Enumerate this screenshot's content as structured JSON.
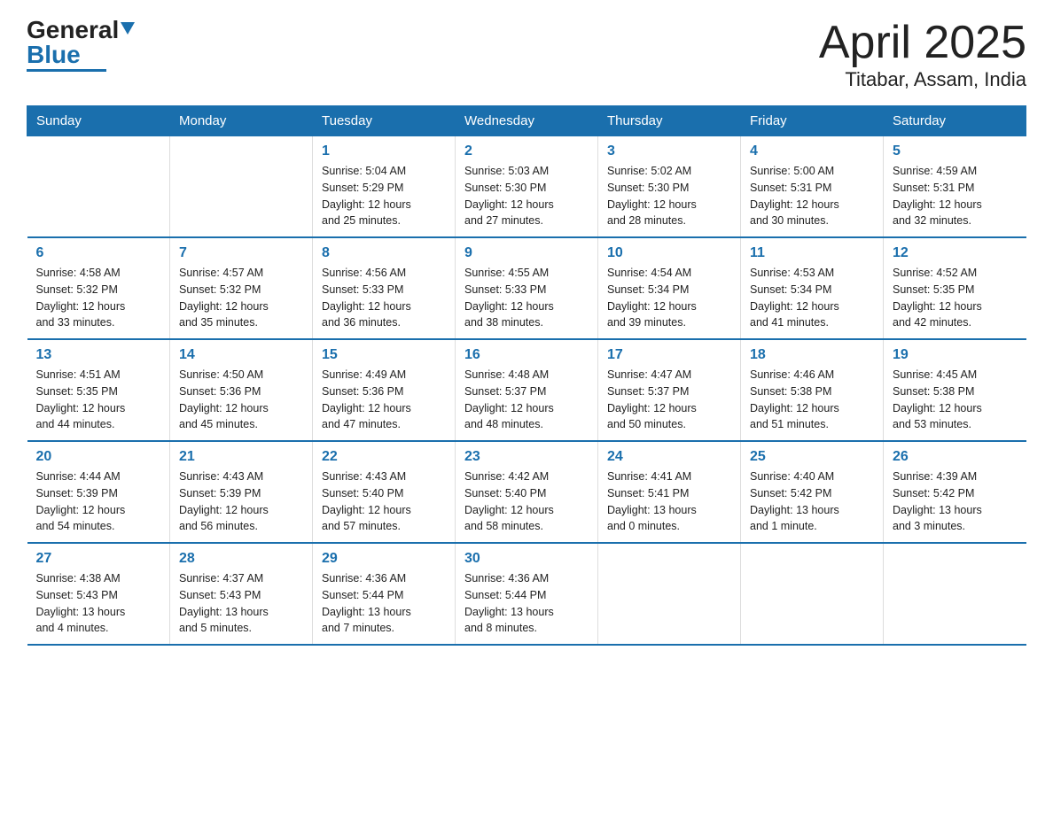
{
  "header": {
    "logo_general": "General",
    "logo_blue": "Blue",
    "month": "April 2025",
    "location": "Titabar, Assam, India"
  },
  "weekdays": [
    "Sunday",
    "Monday",
    "Tuesday",
    "Wednesday",
    "Thursday",
    "Friday",
    "Saturday"
  ],
  "weeks": [
    [
      {
        "day": "",
        "info": ""
      },
      {
        "day": "",
        "info": ""
      },
      {
        "day": "1",
        "info": "Sunrise: 5:04 AM\nSunset: 5:29 PM\nDaylight: 12 hours\nand 25 minutes."
      },
      {
        "day": "2",
        "info": "Sunrise: 5:03 AM\nSunset: 5:30 PM\nDaylight: 12 hours\nand 27 minutes."
      },
      {
        "day": "3",
        "info": "Sunrise: 5:02 AM\nSunset: 5:30 PM\nDaylight: 12 hours\nand 28 minutes."
      },
      {
        "day": "4",
        "info": "Sunrise: 5:00 AM\nSunset: 5:31 PM\nDaylight: 12 hours\nand 30 minutes."
      },
      {
        "day": "5",
        "info": "Sunrise: 4:59 AM\nSunset: 5:31 PM\nDaylight: 12 hours\nand 32 minutes."
      }
    ],
    [
      {
        "day": "6",
        "info": "Sunrise: 4:58 AM\nSunset: 5:32 PM\nDaylight: 12 hours\nand 33 minutes."
      },
      {
        "day": "7",
        "info": "Sunrise: 4:57 AM\nSunset: 5:32 PM\nDaylight: 12 hours\nand 35 minutes."
      },
      {
        "day": "8",
        "info": "Sunrise: 4:56 AM\nSunset: 5:33 PM\nDaylight: 12 hours\nand 36 minutes."
      },
      {
        "day": "9",
        "info": "Sunrise: 4:55 AM\nSunset: 5:33 PM\nDaylight: 12 hours\nand 38 minutes."
      },
      {
        "day": "10",
        "info": "Sunrise: 4:54 AM\nSunset: 5:34 PM\nDaylight: 12 hours\nand 39 minutes."
      },
      {
        "day": "11",
        "info": "Sunrise: 4:53 AM\nSunset: 5:34 PM\nDaylight: 12 hours\nand 41 minutes."
      },
      {
        "day": "12",
        "info": "Sunrise: 4:52 AM\nSunset: 5:35 PM\nDaylight: 12 hours\nand 42 minutes."
      }
    ],
    [
      {
        "day": "13",
        "info": "Sunrise: 4:51 AM\nSunset: 5:35 PM\nDaylight: 12 hours\nand 44 minutes."
      },
      {
        "day": "14",
        "info": "Sunrise: 4:50 AM\nSunset: 5:36 PM\nDaylight: 12 hours\nand 45 minutes."
      },
      {
        "day": "15",
        "info": "Sunrise: 4:49 AM\nSunset: 5:36 PM\nDaylight: 12 hours\nand 47 minutes."
      },
      {
        "day": "16",
        "info": "Sunrise: 4:48 AM\nSunset: 5:37 PM\nDaylight: 12 hours\nand 48 minutes."
      },
      {
        "day": "17",
        "info": "Sunrise: 4:47 AM\nSunset: 5:37 PM\nDaylight: 12 hours\nand 50 minutes."
      },
      {
        "day": "18",
        "info": "Sunrise: 4:46 AM\nSunset: 5:38 PM\nDaylight: 12 hours\nand 51 minutes."
      },
      {
        "day": "19",
        "info": "Sunrise: 4:45 AM\nSunset: 5:38 PM\nDaylight: 12 hours\nand 53 minutes."
      }
    ],
    [
      {
        "day": "20",
        "info": "Sunrise: 4:44 AM\nSunset: 5:39 PM\nDaylight: 12 hours\nand 54 minutes."
      },
      {
        "day": "21",
        "info": "Sunrise: 4:43 AM\nSunset: 5:39 PM\nDaylight: 12 hours\nand 56 minutes."
      },
      {
        "day": "22",
        "info": "Sunrise: 4:43 AM\nSunset: 5:40 PM\nDaylight: 12 hours\nand 57 minutes."
      },
      {
        "day": "23",
        "info": "Sunrise: 4:42 AM\nSunset: 5:40 PM\nDaylight: 12 hours\nand 58 minutes."
      },
      {
        "day": "24",
        "info": "Sunrise: 4:41 AM\nSunset: 5:41 PM\nDaylight: 13 hours\nand 0 minutes."
      },
      {
        "day": "25",
        "info": "Sunrise: 4:40 AM\nSunset: 5:42 PM\nDaylight: 13 hours\nand 1 minute."
      },
      {
        "day": "26",
        "info": "Sunrise: 4:39 AM\nSunset: 5:42 PM\nDaylight: 13 hours\nand 3 minutes."
      }
    ],
    [
      {
        "day": "27",
        "info": "Sunrise: 4:38 AM\nSunset: 5:43 PM\nDaylight: 13 hours\nand 4 minutes."
      },
      {
        "day": "28",
        "info": "Sunrise: 4:37 AM\nSunset: 5:43 PM\nDaylight: 13 hours\nand 5 minutes."
      },
      {
        "day": "29",
        "info": "Sunrise: 4:36 AM\nSunset: 5:44 PM\nDaylight: 13 hours\nand 7 minutes."
      },
      {
        "day": "30",
        "info": "Sunrise: 4:36 AM\nSunset: 5:44 PM\nDaylight: 13 hours\nand 8 minutes."
      },
      {
        "day": "",
        "info": ""
      },
      {
        "day": "",
        "info": ""
      },
      {
        "day": "",
        "info": ""
      }
    ]
  ]
}
